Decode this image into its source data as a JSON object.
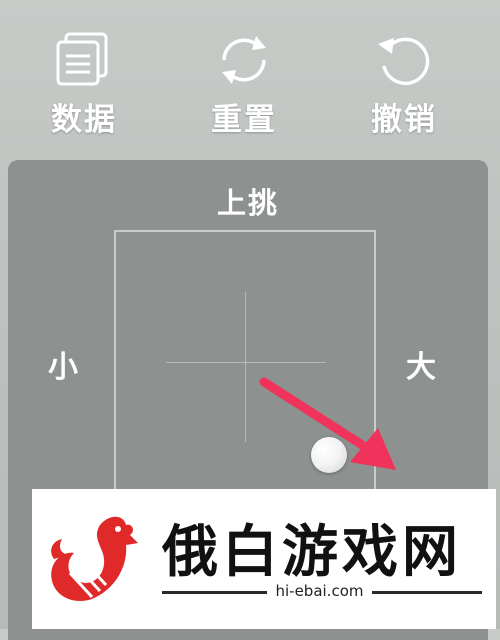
{
  "toolbar": {
    "data_label": "数据",
    "reset_label": "重置",
    "undo_label": "撤销"
  },
  "panel": {
    "title": "上挑",
    "left_label": "小",
    "right_label": "大"
  },
  "watermark": {
    "brand_text": "俄白游戏网",
    "url": "hi-ebai.com",
    "logo_color": "#e02a2a"
  },
  "colors": {
    "arrow": "#f0335a",
    "panel": "#8d918f",
    "background": "#c2c6c3"
  },
  "icons": [
    "data-icon",
    "reset-icon",
    "undo-icon",
    "rooster-logo-icon"
  ]
}
